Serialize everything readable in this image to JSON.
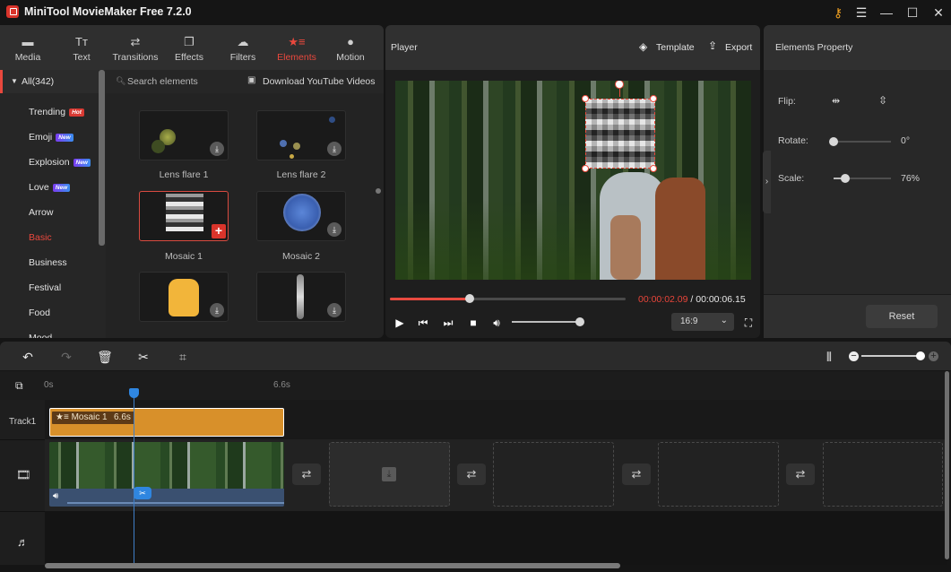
{
  "app": {
    "title": "MiniTool MovieMaker Free 7.2.0"
  },
  "window": {
    "icons": [
      "key-icon",
      "menu-icon",
      "minimize-icon",
      "maximize-icon",
      "close-icon"
    ]
  },
  "library": {
    "tabs": [
      {
        "label": "Media",
        "icon": "folder-icon"
      },
      {
        "label": "Text",
        "icon": "text-icon"
      },
      {
        "label": "Transitions",
        "icon": "transitions-icon"
      },
      {
        "label": "Effects",
        "icon": "effects-icon"
      },
      {
        "label": "Filters",
        "icon": "filters-icon"
      },
      {
        "label": "Elements",
        "icon": "elements-icon",
        "active": true
      },
      {
        "label": "Motion",
        "icon": "motion-icon"
      }
    ],
    "categories": {
      "all": "All(342)",
      "items": [
        {
          "label": "Trending",
          "badge": "Hot"
        },
        {
          "label": "Emoji",
          "badge": "New"
        },
        {
          "label": "Explosion",
          "badge": "New"
        },
        {
          "label": "Love",
          "badge": "New"
        },
        {
          "label": "Arrow"
        },
        {
          "label": "Basic",
          "active": true
        },
        {
          "label": "Business"
        },
        {
          "label": "Festival"
        },
        {
          "label": "Food"
        },
        {
          "label": "Mood"
        }
      ]
    },
    "search_placeholder": "Search elements",
    "download_youtube": "Download YouTube Videos",
    "elements": [
      {
        "label": "Lens flare 1",
        "action": "download"
      },
      {
        "label": "Lens flare 2",
        "action": "download"
      },
      {
        "label": "Mosaic 1",
        "action": "add",
        "selected": true
      },
      {
        "label": "Mosaic 2",
        "action": "download"
      },
      {
        "label": "",
        "action": "download"
      },
      {
        "label": "",
        "action": "download"
      }
    ]
  },
  "player": {
    "title": "Player",
    "template": "Template",
    "export": "Export",
    "current_time": "00:00:02.09",
    "separator": " / ",
    "total_time": "00:00:06.15",
    "progress_fraction": 0.34,
    "volume_fraction": 1.0,
    "aspect_ratio": "16:9"
  },
  "properties": {
    "title": "Elements Property",
    "flip_label": "Flip:",
    "rotate_label": "Rotate:",
    "rotate_value": "0°",
    "rotate_fraction": 0.0,
    "scale_label": "Scale:",
    "scale_value": "76%",
    "scale_fraction": 0.2,
    "reset": "Reset"
  },
  "timeline": {
    "ruler": [
      "0s",
      "6.6s"
    ],
    "tracks": [
      "Track1"
    ],
    "clip": {
      "name": "Mosaic 1",
      "duration": "6.6s"
    },
    "zoom_fraction": 1.0
  },
  "colors": {
    "accent": "#e9483d",
    "clip": "#d8902a",
    "playhead": "#2f86e0"
  }
}
